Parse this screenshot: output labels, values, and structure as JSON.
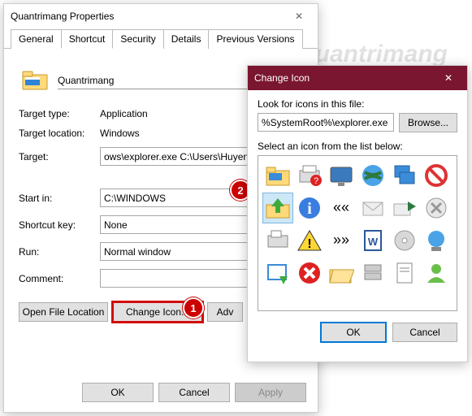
{
  "props": {
    "title": "Quantrimang Properties",
    "tabs": [
      "General",
      "Shortcut",
      "Security",
      "Details",
      "Previous Versions"
    ],
    "shortcutName": "Quantrimang",
    "rows": {
      "targetType": {
        "label": "Target type:",
        "value": "Application"
      },
      "targetLoc": {
        "label": "Target location:",
        "value": "Windows"
      },
      "target": {
        "label": "Target:",
        "value": "ows\\explorer.exe C:\\Users\\HuyenSP\\"
      },
      "startIn": {
        "label": "Start in:",
        "value": "C:\\WINDOWS"
      },
      "shortcutKey": {
        "label": "Shortcut key:",
        "value": "None"
      },
      "run": {
        "label": "Run:",
        "value": "Normal window"
      },
      "comment": {
        "label": "Comment:",
        "value": ""
      }
    },
    "buttons": {
      "openLoc": "Open File Location",
      "changeIcon": "Change Icon...",
      "advanced": "Adv"
    },
    "footer": {
      "ok": "OK",
      "cancel": "Cancel",
      "apply": "Apply"
    }
  },
  "dlg": {
    "title": "Change Icon",
    "lookLabel": "Look for icons in this file:",
    "path": "%SystemRoot%\\explorer.exe",
    "browse": "Browse...",
    "selectLabel": "Select an icon from the list below:",
    "ok": "OK",
    "cancel": "Cancel"
  },
  "markers": {
    "m1": "1",
    "m2": "2"
  },
  "watermark": "uantrimang"
}
